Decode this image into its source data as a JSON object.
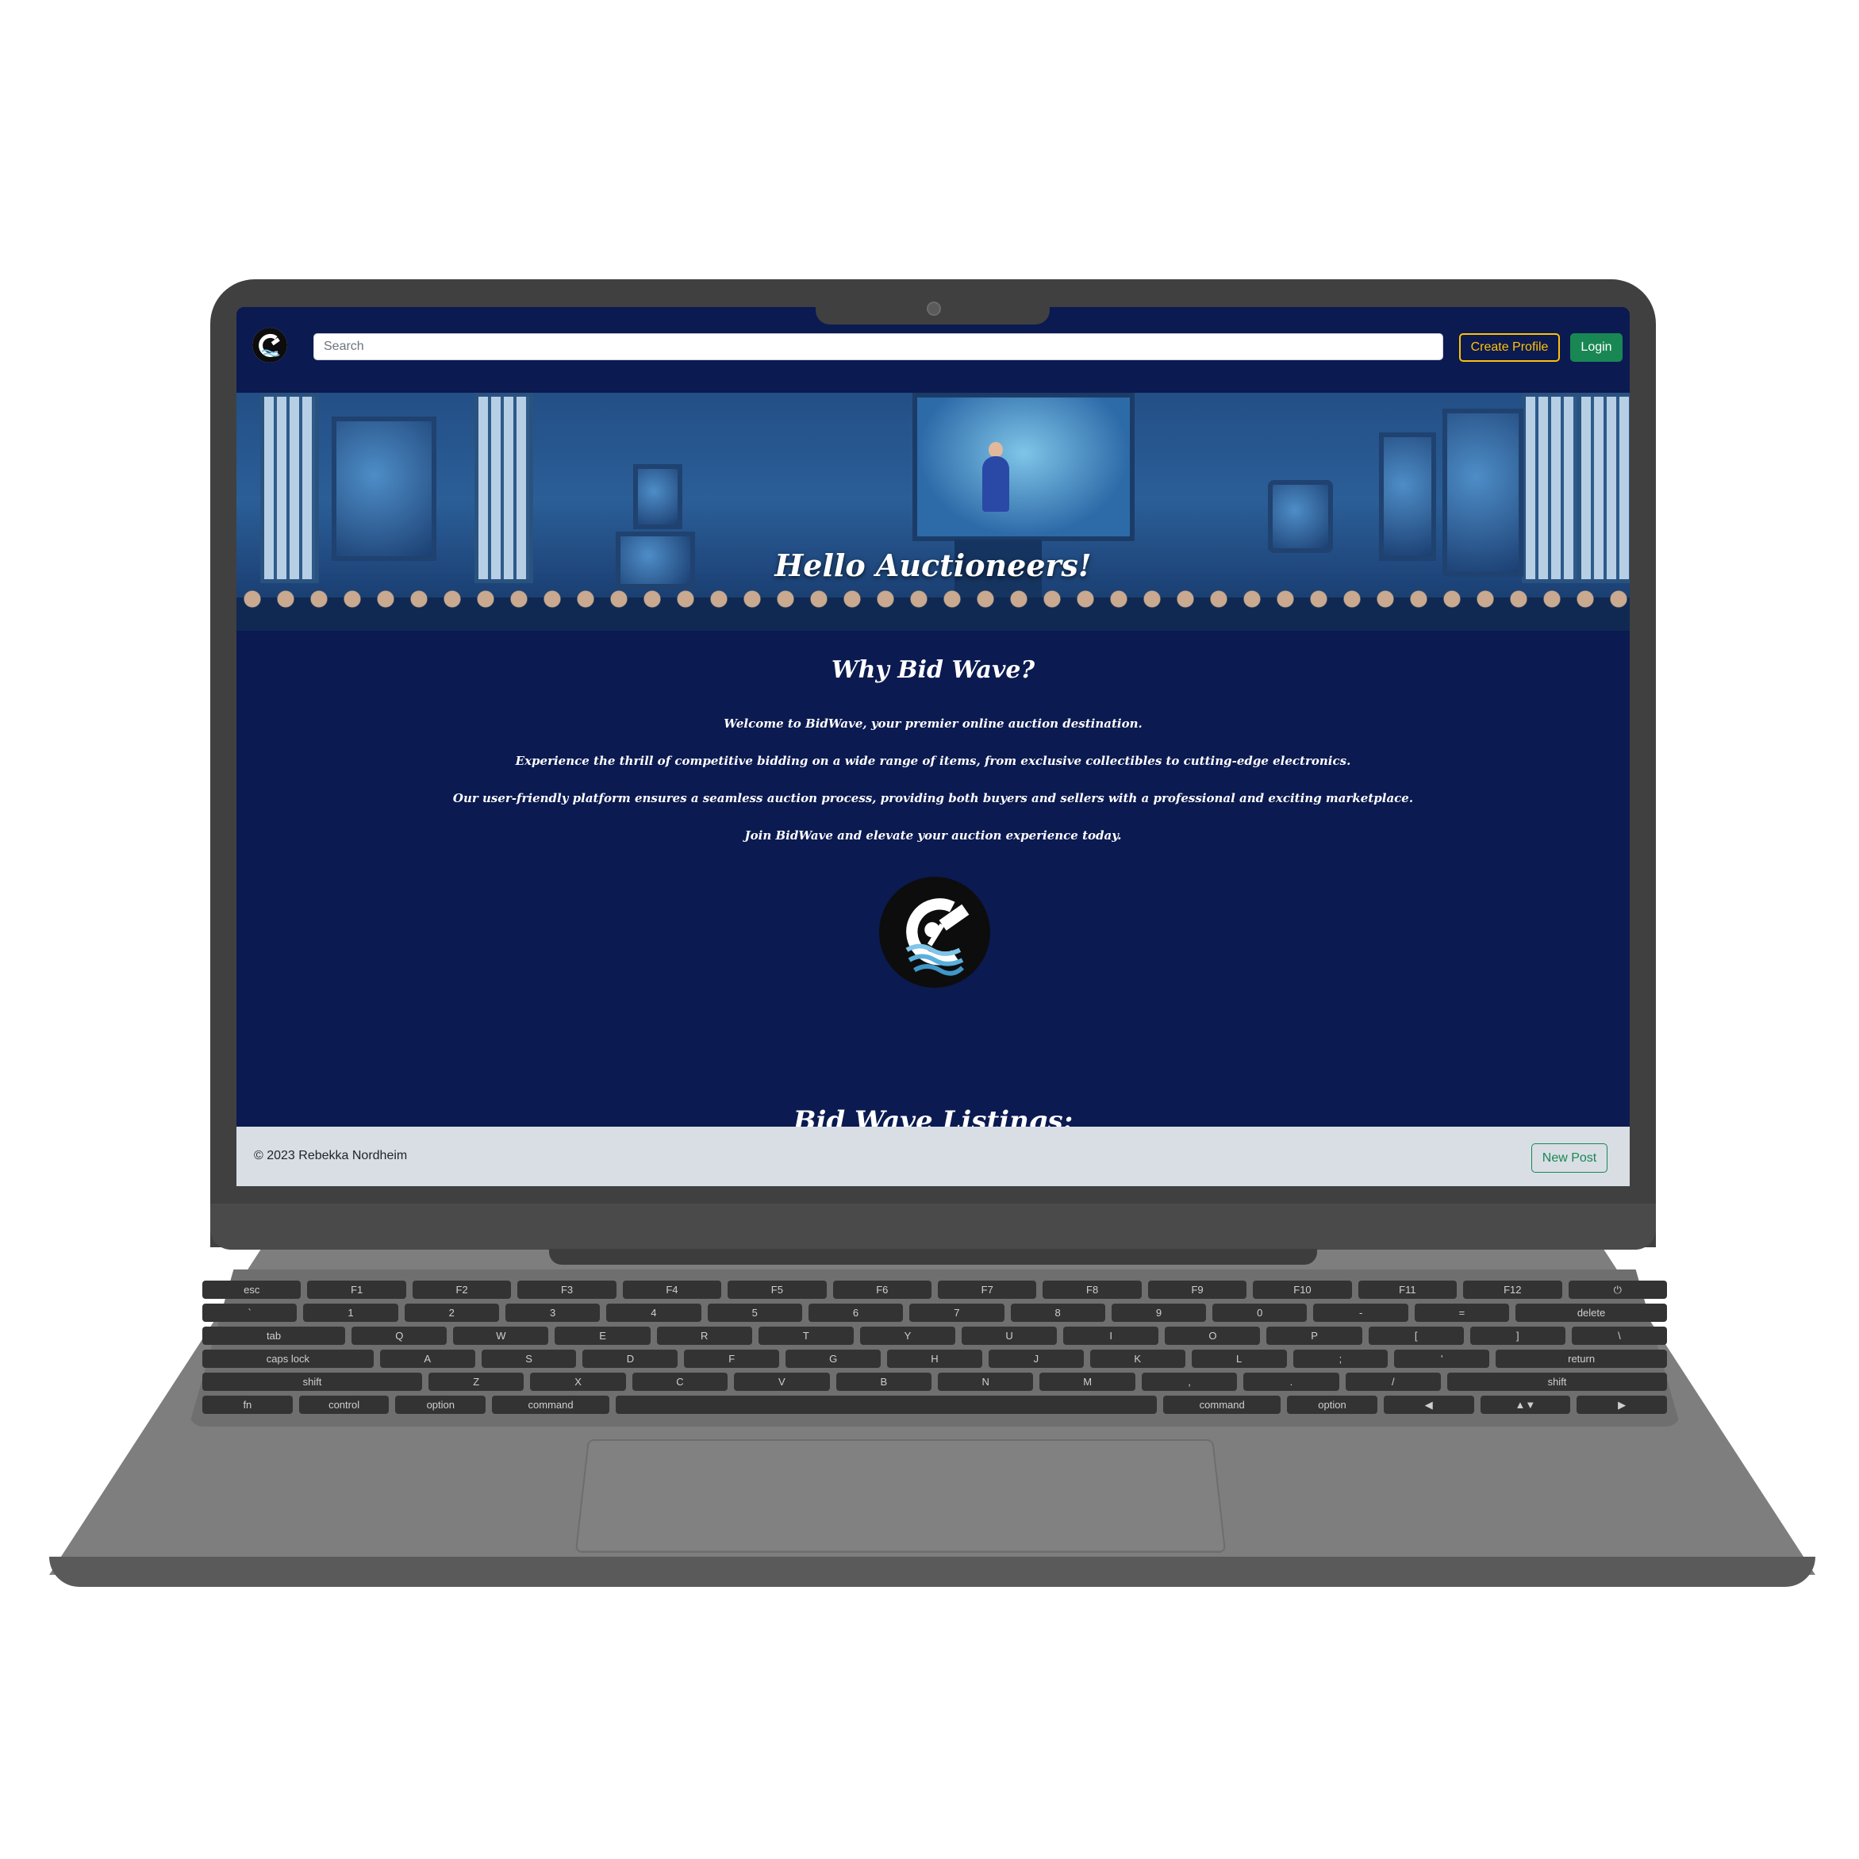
{
  "navbar": {
    "logo_icon": "bidwave-logo-icon",
    "search_placeholder": "Search",
    "create_profile_label": "Create Profile",
    "login_label": "Login"
  },
  "hero": {
    "title": "Hello Auctioneers!"
  },
  "about": {
    "heading": "Why Bid Wave?",
    "paragraphs": [
      "Welcome to BidWave, your premier online auction destination.",
      "Experience the thrill of competitive bidding on a wide range of items, from exclusive collectibles to cutting-edge electronics.",
      "Our user-friendly platform ensures a seamless auction process, providing both buyers and sellers with a professional and exciting marketplace.",
      "Join BidWave and elevate your auction experience today."
    ],
    "logo_icon": "bidwave-logo-icon"
  },
  "listings": {
    "heading": "Bid Wave Listings:"
  },
  "footer": {
    "copyright": "© 2023 Rebekka Nordheim",
    "new_post_label": "New Post"
  },
  "colors": {
    "page_bg": "#0b1a50",
    "accent_yellow": "#ffc107",
    "success_green": "#198754",
    "footer_bg": "#d8dee4"
  }
}
